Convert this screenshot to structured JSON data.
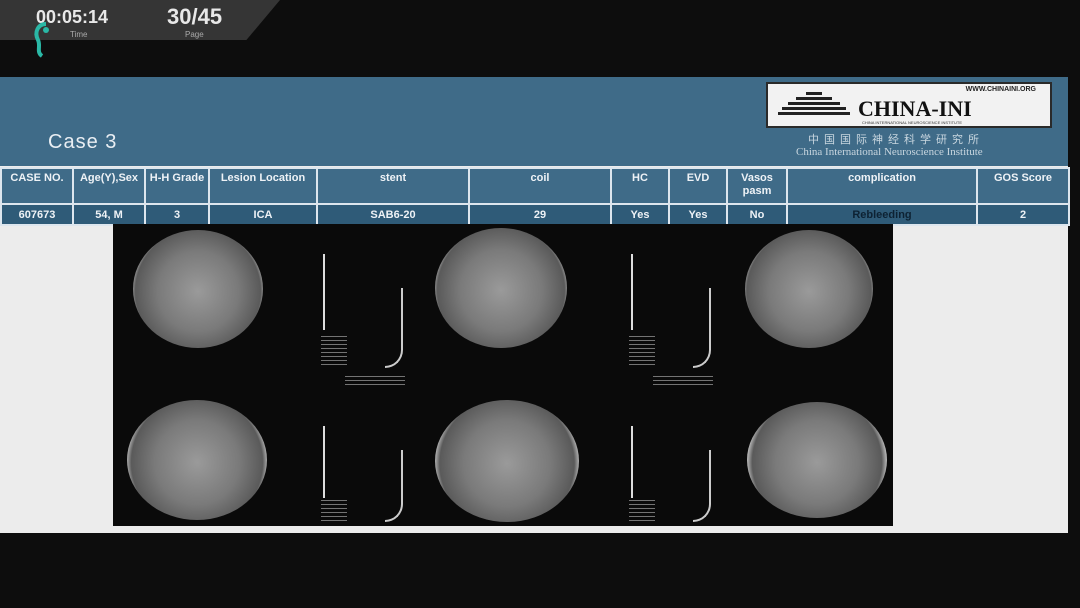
{
  "overlay": {
    "time": "00:05:14",
    "time_label": "Time",
    "page": "30/45",
    "page_label": "Page"
  },
  "slide": {
    "title": "Case  3",
    "logo": {
      "url": "WWW.CHINAINI.ORG",
      "name": "CHINA-INI",
      "subtitle": "CHINA INTERNATIONAL NEUROSCIENCE INSTITUTE",
      "cn": "中国国际神经科学研究所",
      "en": "China International Neuroscience Institute"
    }
  },
  "table": {
    "headers": [
      "CASE NO.",
      "Age(Y),Sex",
      "H-H Grade",
      "Lesion Location",
      "stent",
      "coil",
      "HC",
      "EVD",
      "Vasos pasm",
      "complication",
      "GOS Score"
    ],
    "rows": [
      [
        "607673",
        "54, M",
        "3",
        "ICA",
        "SAB6-20",
        "29",
        "Yes",
        "Yes",
        "No",
        "Rebleeding",
        "2"
      ]
    ]
  },
  "ct_images": {
    "label": "CT scans",
    "count": 6
  }
}
